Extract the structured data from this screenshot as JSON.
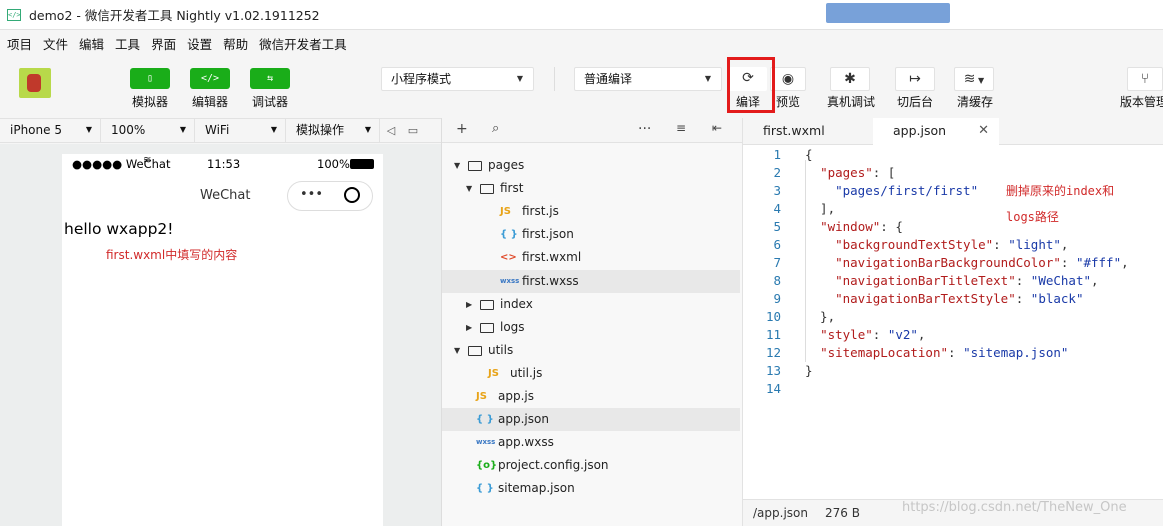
{
  "window": {
    "title": "demo2 - 微信开发者工具 Nightly v1.02.1911252"
  },
  "menu": [
    "项目",
    "文件",
    "编辑",
    "工具",
    "界面",
    "设置",
    "帮助",
    "微信开发者工具"
  ],
  "toolbar": {
    "simulator_label": "模拟器",
    "editor_label": "编辑器",
    "debugger_label": "调试器",
    "mode_select": "小程序模式",
    "compile_select": "普通编译",
    "compile_label": "编译",
    "preview_label": "预览",
    "remote_debug_label": "真机调试",
    "background_label": "切后台",
    "clear_cache_label": "清缓存",
    "version_label": "版本管理"
  },
  "simulator_bar": {
    "device": "iPhone 5",
    "zoom": "100%",
    "network": "WiFi",
    "operation": "模拟操作"
  },
  "phone": {
    "carrier": "●●●●● WeChat",
    "time": "11:53",
    "battery": "100%",
    "nav_title": "WeChat",
    "content": "hello wxapp2!",
    "annotation": "first.wxml中填写的内容"
  },
  "file_tree": [
    {
      "label": "pages",
      "kind": "folder",
      "open": true,
      "depth": 0
    },
    {
      "label": "first",
      "kind": "folder",
      "open": true,
      "depth": 1
    },
    {
      "label": "first.js",
      "kind": "js",
      "depth": 2
    },
    {
      "label": "first.json",
      "kind": "json",
      "depth": 2
    },
    {
      "label": "first.wxml",
      "kind": "wxml",
      "depth": 2
    },
    {
      "label": "first.wxss",
      "kind": "wxss",
      "depth": 2,
      "selected": true
    },
    {
      "label": "index",
      "kind": "folder",
      "open": false,
      "depth": 1
    },
    {
      "label": "logs",
      "kind": "folder",
      "open": false,
      "depth": 1
    },
    {
      "label": "utils",
      "kind": "folder",
      "open": true,
      "depth": 0
    },
    {
      "label": "util.js",
      "kind": "js",
      "depth": 1
    },
    {
      "label": "app.js",
      "kind": "js",
      "depth": 0
    },
    {
      "label": "app.json",
      "kind": "json",
      "depth": 0,
      "selected": true
    },
    {
      "label": "app.wxss",
      "kind": "wxss",
      "depth": 0
    },
    {
      "label": "project.config.json",
      "kind": "config",
      "depth": 0
    },
    {
      "label": "sitemap.json",
      "kind": "json",
      "depth": 0
    }
  ],
  "editor": {
    "tabs": [
      "first.wxml",
      "app.json"
    ],
    "active_tab": "app.json",
    "code": [
      "{",
      "  \"pages\": [",
      "    \"pages/first/first\"",
      "  ],",
      "  \"window\": {",
      "    \"backgroundTextStyle\": \"light\",",
      "    \"navigationBarBackgroundColor\": \"#fff\",",
      "    \"navigationBarTitleText\": \"WeChat\",",
      "    \"navigationBarTextStyle\": \"black\"",
      "  },",
      "  \"style\": \"v2\",",
      "  \"sitemapLocation\": \"sitemap.json\"",
      "}",
      ""
    ],
    "annotation_line1": "删掉原来的index和",
    "annotation_line2": "logs路径",
    "footer_path": "/app.json",
    "footer_size": "276 B"
  },
  "watermark": "https://blog.csdn.net/TheNew_One",
  "colors": {
    "accent_green": "#1aad19",
    "highlight_red": "#e31b1b",
    "json_key": "#b11c1c",
    "json_string": "#1a3aa8"
  }
}
